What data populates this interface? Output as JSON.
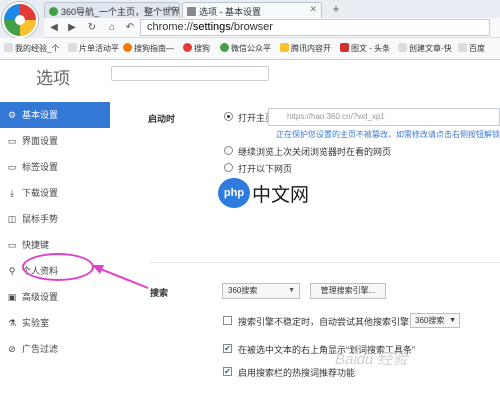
{
  "browser": {
    "tabs": [
      {
        "title": "360导航_一个主页，整个世界",
        "active": false
      },
      {
        "title": "选项 - 基本设置",
        "active": true
      }
    ],
    "new_tab_label": "+",
    "address": {
      "scheme": "chrome://",
      "host": "settings",
      "path": "/browser"
    },
    "bookmarks": [
      "我的经验_个",
      "片单活动平",
      "搜狗指南—",
      "搜狗",
      "微信公众平",
      "腾讯内容开",
      "图文 - 头条",
      "创建文章-快",
      "百度"
    ]
  },
  "page": {
    "title": "选项"
  },
  "sidebar": {
    "items": [
      {
        "label": "基本设置",
        "icon": "gear-icon",
        "glyph": "⚙"
      },
      {
        "label": "界面设置",
        "icon": "window-icon",
        "glyph": "▭"
      },
      {
        "label": "标签设置",
        "icon": "tabs-icon",
        "glyph": "▭"
      },
      {
        "label": "下载设置",
        "icon": "download-icon",
        "glyph": "⤓"
      },
      {
        "label": "鼠标手势",
        "icon": "mouse-icon",
        "glyph": "◫"
      },
      {
        "label": "快捷键",
        "icon": "keyboard-icon",
        "glyph": "▭"
      },
      {
        "label": "个人资料",
        "icon": "search-person-icon",
        "glyph": "⚲"
      },
      {
        "label": "高级设置",
        "icon": "advanced-icon",
        "glyph": "▣"
      },
      {
        "label": "实验室",
        "icon": "lab-icon",
        "glyph": "⚗"
      },
      {
        "label": "广告过滤",
        "icon": "block-icon",
        "glyph": "⊘"
      }
    ]
  },
  "startup": {
    "label": "启动时",
    "options": [
      "打开主页",
      "继续浏览上次关闭浏览器时在看的网页",
      "打开以下网页"
    ],
    "selected_index": 0,
    "homepage_value": "https://hao.360.cn/?wd_xp1",
    "protection_note": "正在保护您设置的主页不被篡改，如需修改请点击右侧按钮解锁"
  },
  "search": {
    "label": "搜索",
    "engine": "360搜索",
    "manage_button": "管理搜索引擎...",
    "fallback_text": "搜索引擎不稳定时，自动尝试其他搜索引擎：",
    "fallback_engine": "360搜索",
    "fallback_checked": false,
    "show_toolbar_text": "在被选中文本的右上角显示“划词搜索工具条”",
    "show_toolbar_checked": true,
    "hot_words_text": "启用搜索栏的热搜词推荐功能",
    "hot_words_checked": true
  },
  "watermark": {
    "brand": "php",
    "text": "中文网",
    "bottom": "Baidu 经验"
  },
  "colors": {
    "accent": "#3478d6",
    "annotation": "#e040c8"
  }
}
